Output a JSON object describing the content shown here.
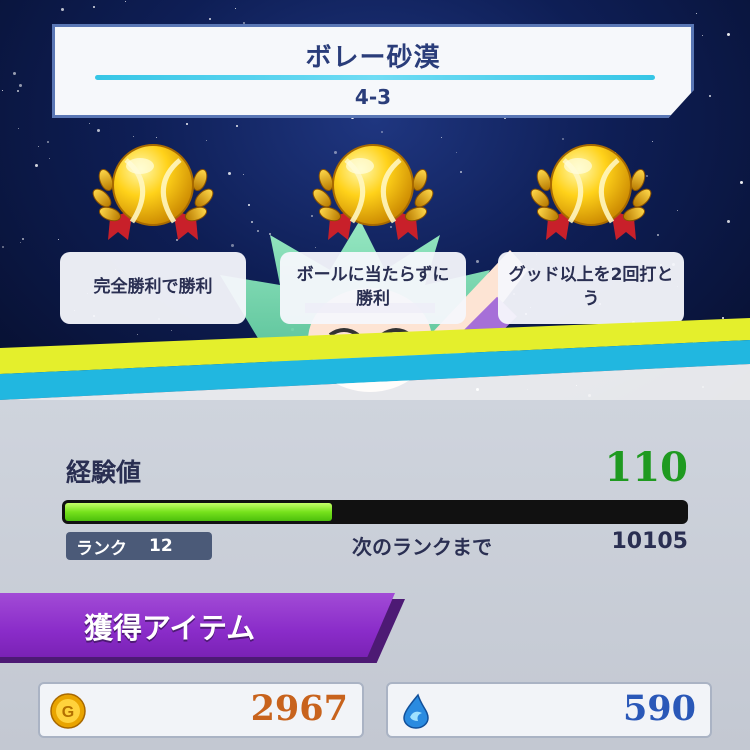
{
  "stage": {
    "title": "ボレー砂漠",
    "number": "4-3"
  },
  "missions": [
    {
      "label": "完全勝利で勝利",
      "icon": "gold-tennis-ball-medal-icon"
    },
    {
      "label": "ボールに当たらずに勝利",
      "icon": "gold-tennis-ball-medal-icon"
    },
    {
      "label": "グッド以上を2回打とう",
      "icon": "gold-tennis-ball-medal-icon"
    }
  ],
  "experience": {
    "label": "経験値",
    "value": "110",
    "progress": 0.43
  },
  "rank": {
    "label": "ランク",
    "value": "12"
  },
  "next_rank": {
    "label": "次のランクまで",
    "value": "10105"
  },
  "items": {
    "heading": "獲得アイテム"
  },
  "currency": {
    "coins": {
      "icon": "gold-coin-icon",
      "value": "2967"
    },
    "gems": {
      "icon": "blue-water-drop-icon",
      "value": "590"
    }
  },
  "colors": {
    "exp_value": "#1f9a20",
    "coins_value": "#c8631d",
    "gems_value": "#2a58b8",
    "banner": "#8a2cc9",
    "stripe_cyan": "#21b7e0",
    "stripe_yellow": "#e4ef2c"
  }
}
